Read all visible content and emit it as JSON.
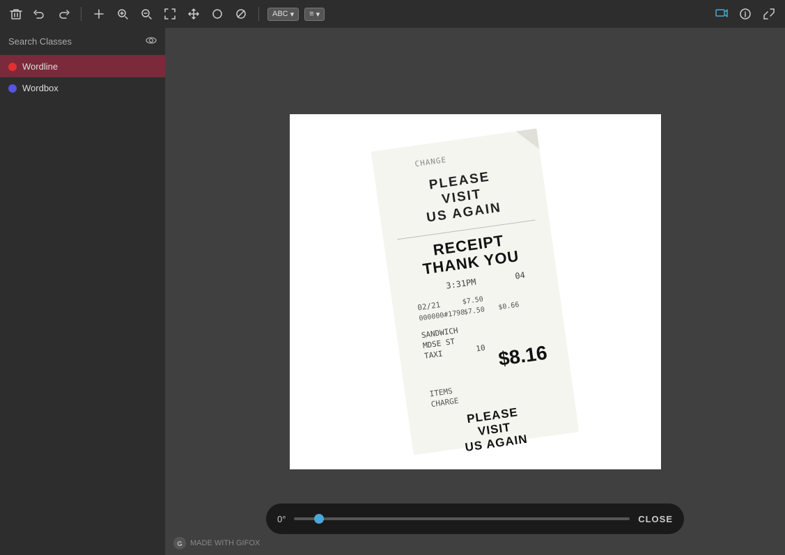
{
  "toolbar": {
    "tools": [
      {
        "name": "delete",
        "icon": "🗑",
        "label": "Delete"
      },
      {
        "name": "undo",
        "icon": "↩",
        "label": "Undo"
      },
      {
        "name": "redo",
        "icon": "↪",
        "label": "Redo"
      },
      {
        "name": "add",
        "icon": "+",
        "label": "Add"
      },
      {
        "name": "zoom-in",
        "icon": "⊕",
        "label": "Zoom In"
      },
      {
        "name": "zoom-out",
        "icon": "⊖",
        "label": "Zoom Out"
      },
      {
        "name": "fit",
        "icon": "⛶",
        "label": "Fit"
      },
      {
        "name": "move",
        "icon": "✛",
        "label": "Move"
      },
      {
        "name": "circle",
        "icon": "○",
        "label": "Circle"
      },
      {
        "name": "block",
        "icon": "⊘",
        "label": "Block"
      },
      {
        "name": "ban",
        "icon": "⌀",
        "label": "Ban"
      }
    ],
    "badge_text": "ABC",
    "badge_dropdown": "▾",
    "lines_icon": "≡",
    "info_icon": "ⓘ",
    "expand_icon": "⤢"
  },
  "sidebar": {
    "search_placeholder": "Search Classes",
    "eye_icon": "👁",
    "classes": [
      {
        "name": "Wordline",
        "color": "#e03030",
        "active": true
      },
      {
        "name": "Wordbox",
        "color": "#5555dd",
        "active": false
      }
    ]
  },
  "canvas": {
    "image_alt": "Receipt image"
  },
  "bottom_bar": {
    "angle": "0°",
    "slider_value": 0,
    "close_label": "CLOSE"
  },
  "branding": {
    "text": "MADE WITH GIFOX"
  }
}
